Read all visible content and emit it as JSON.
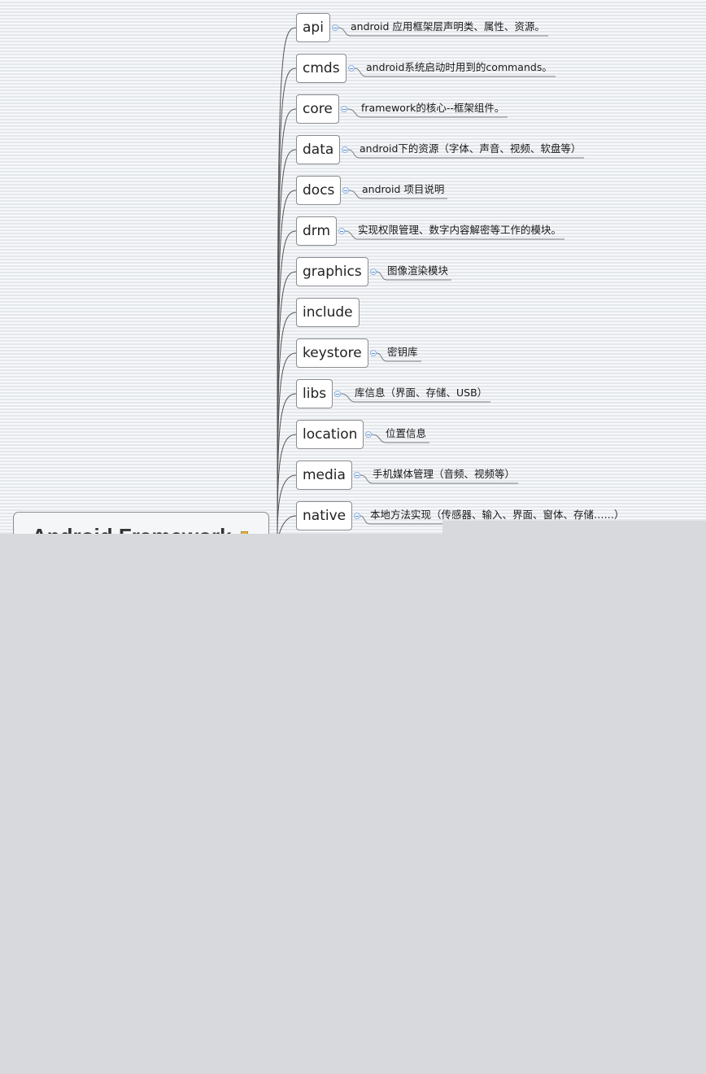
{
  "root": {
    "title": "Android Framework"
  },
  "branches": [
    {
      "label": "api",
      "note": "android 应用框架层声明类、属性、资源。"
    },
    {
      "label": "cmds",
      "note": "android系统启动时用到的commands。"
    },
    {
      "label": "core",
      "note": "framework的核心--框架组件。"
    },
    {
      "label": "data",
      "note": "android下的资源（字体、声音、视频、软盘等）"
    },
    {
      "label": "docs",
      "note": "android 项目说明"
    },
    {
      "label": "drm",
      "note": "实现权限管理、数字内容解密等工作的模块。"
    },
    {
      "label": "graphics",
      "note": "图像渲染模块"
    },
    {
      "label": "include",
      "note": ""
    },
    {
      "label": "keystore",
      "note": "密钥库"
    },
    {
      "label": "libs",
      "note": "库信息（界面、存储、USB）"
    },
    {
      "label": "location",
      "note": "位置信息"
    },
    {
      "label": "media",
      "note": "手机媒体管理（音频、视频等）"
    },
    {
      "label": "native",
      "note": "本地方法实现（传感器、输入、界面、窗体、存储……）"
    }
  ],
  "colors": {
    "connector": "#555555",
    "note_underline": "#7a7c80",
    "toggle_border": "#8fb4de",
    "node_border": "#8a8c90"
  }
}
